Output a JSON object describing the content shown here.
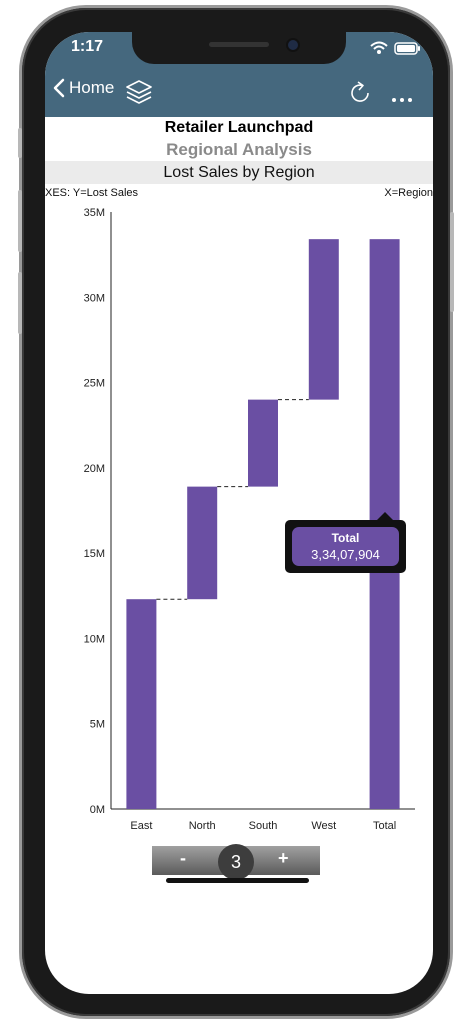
{
  "status_bar": {
    "time": "1:17"
  },
  "nav": {
    "back_label": "Home"
  },
  "header": {
    "title": "Retailer Launchpad",
    "subtitle": "Regional Analysis",
    "chart_title": "Lost Sales by Region"
  },
  "axes": {
    "left": "XES:  Y=Lost Sales",
    "right": "X=Region"
  },
  "chart_data": {
    "type": "bar",
    "subtype": "waterfall",
    "title": "Lost Sales by Region",
    "xlabel": "Region",
    "ylabel": "Lost Sales",
    "categories": [
      "East",
      "North",
      "South",
      "West",
      "Total"
    ],
    "series": [
      {
        "name": "Lost Sales",
        "starts": [
          0,
          12300000,
          18900000,
          24000000,
          0
        ],
        "ends": [
          12300000,
          18900000,
          24000000,
          33407904,
          33407904
        ]
      }
    ],
    "ylim": [
      0,
      35000000
    ],
    "yticks": [
      "0M",
      "5M",
      "10M",
      "15M",
      "20M",
      "25M",
      "30M",
      "35M"
    ],
    "bar_color": "#6a4fa3",
    "connectors": "dashed"
  },
  "tooltip": {
    "title": "Total",
    "value": "3,34,07,904"
  },
  "pager": {
    "minus": "-",
    "page": "3",
    "plus": "+"
  },
  "colors": {
    "topbar": "#45687e",
    "bar": "#6a4fa3"
  }
}
